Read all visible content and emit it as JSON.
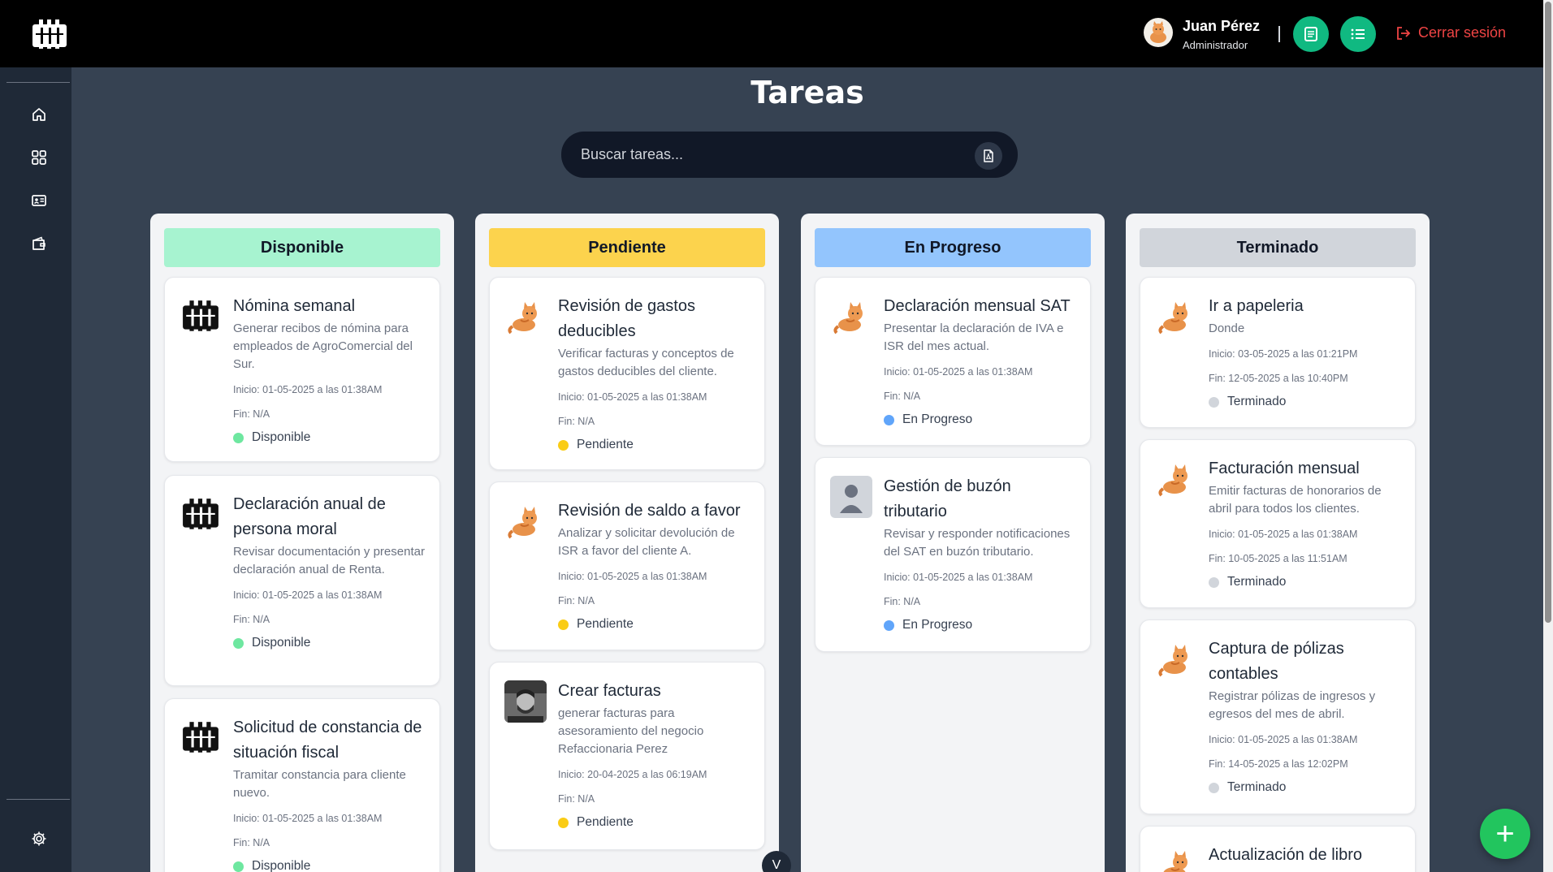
{
  "header": {
    "user_name": "Juan Pérez",
    "user_role": "Administrador",
    "logout_label": "Cerrar sesión",
    "accent_color": "#10b981"
  },
  "sidebar": {
    "items": [
      {
        "icon": "home-icon"
      },
      {
        "icon": "grid-icon"
      },
      {
        "icon": "id-card-icon"
      },
      {
        "icon": "wallet-icon"
      }
    ],
    "settings_icon": "gear-icon"
  },
  "main": {
    "title": "Tareas",
    "search_placeholder": "Buscar tareas..."
  },
  "columns": [
    {
      "label": "Disponible",
      "color": "#a7f3d0",
      "dot_color": "#6ee7a0",
      "cards": [
        {
          "title": "Nómina semanal",
          "desc": "Generar recibos de nómina para empleados de AgroComercial del Sur.",
          "start": "Inicio: 01-05-2025 a las 01:38AM",
          "end": "Fin: N/A",
          "status": "Disponible",
          "avatar": "logo"
        },
        {
          "title": "Declaración anual de persona moral",
          "desc": "Revisar documentación y presentar declaración anual de Renta.",
          "start": "Inicio: 01-05-2025 a las 01:38AM",
          "end": "Fin: N/A",
          "status": "Disponible",
          "avatar": "logo"
        },
        {
          "title": "Solicitud de constancia de situación fiscal",
          "desc": "Tramitar constancia para cliente nuevo.",
          "start": "Inicio: 01-05-2025 a las 01:38AM",
          "end": "Fin: N/A",
          "status": "Disponible",
          "avatar": "logo"
        }
      ]
    },
    {
      "label": "Pendiente",
      "color": "#fcd34d",
      "dot_color": "#facc15",
      "cards": [
        {
          "title": "Revisión de gastos deducibles",
          "desc": "Verificar facturas y conceptos de gastos deducibles del cliente.",
          "start": "Inicio: 01-05-2025 a las 01:38AM",
          "end": "Fin: N/A",
          "status": "Pendiente",
          "avatar": "cat"
        },
        {
          "title": "Revisión de saldo a favor",
          "desc": "Analizar y solicitar devolución de ISR a favor del cliente A.",
          "start": "Inicio: 01-05-2025 a las 01:38AM",
          "end": "Fin: N/A",
          "status": "Pendiente",
          "avatar": "cat"
        },
        {
          "title": "Crear facturas",
          "desc": "generar facturas para asesoramiento del negocio Refaccionaria Perez",
          "start": "Inicio: 20-04-2025 a las 06:19AM",
          "end": "Fin: N/A",
          "status": "Pendiente",
          "avatar": "photo"
        }
      ]
    },
    {
      "label": "En Progreso",
      "color": "#93c5fd",
      "dot_color": "#60a5fa",
      "cards": [
        {
          "title": "Declaración mensual SAT",
          "desc": "Presentar la declaración de IVA e ISR del mes actual.",
          "start": "Inicio: 01-05-2025 a las 01:38AM",
          "end": "Fin: N/A",
          "status": "En Progreso",
          "avatar": "cat"
        },
        {
          "title": "Gestión de buzón tributario",
          "desc": "Revisar y responder notificaciones del SAT en buzón tributario.",
          "start": "Inicio: 01-05-2025 a las 01:38AM",
          "end": "Fin: N/A",
          "status": "En Progreso",
          "avatar": "user"
        }
      ]
    },
    {
      "label": "Terminado",
      "color": "#d1d5db",
      "dot_color": "#d1d5db",
      "cards": [
        {
          "title": "Ir a papeleria",
          "desc": "Donde",
          "start": "Inicio: 03-05-2025 a las 01:21PM",
          "end": "Fin: 12-05-2025 a las 10:40PM",
          "status": "Terminado",
          "avatar": "cat"
        },
        {
          "title": "Facturación mensual",
          "desc": "Emitir facturas de honorarios de abril para todos los clientes.",
          "start": "Inicio: 01-05-2025 a las 01:38AM",
          "end": "Fin: 10-05-2025 a las 11:51AM",
          "status": "Terminado",
          "avatar": "cat"
        },
        {
          "title": "Captura de pólizas contables",
          "desc": "Registrar pólizas de ingresos y egresos del mes de abril.",
          "start": "Inicio: 01-05-2025 a las 01:38AM",
          "end": "Fin: 14-05-2025 a las 12:02PM",
          "status": "Terminado",
          "avatar": "cat"
        },
        {
          "title": "Actualización de libro",
          "desc": "",
          "start": "",
          "end": "",
          "status": "",
          "avatar": "cat"
        }
      ]
    }
  ],
  "fab_label": "+",
  "scroll_down_label": "V"
}
